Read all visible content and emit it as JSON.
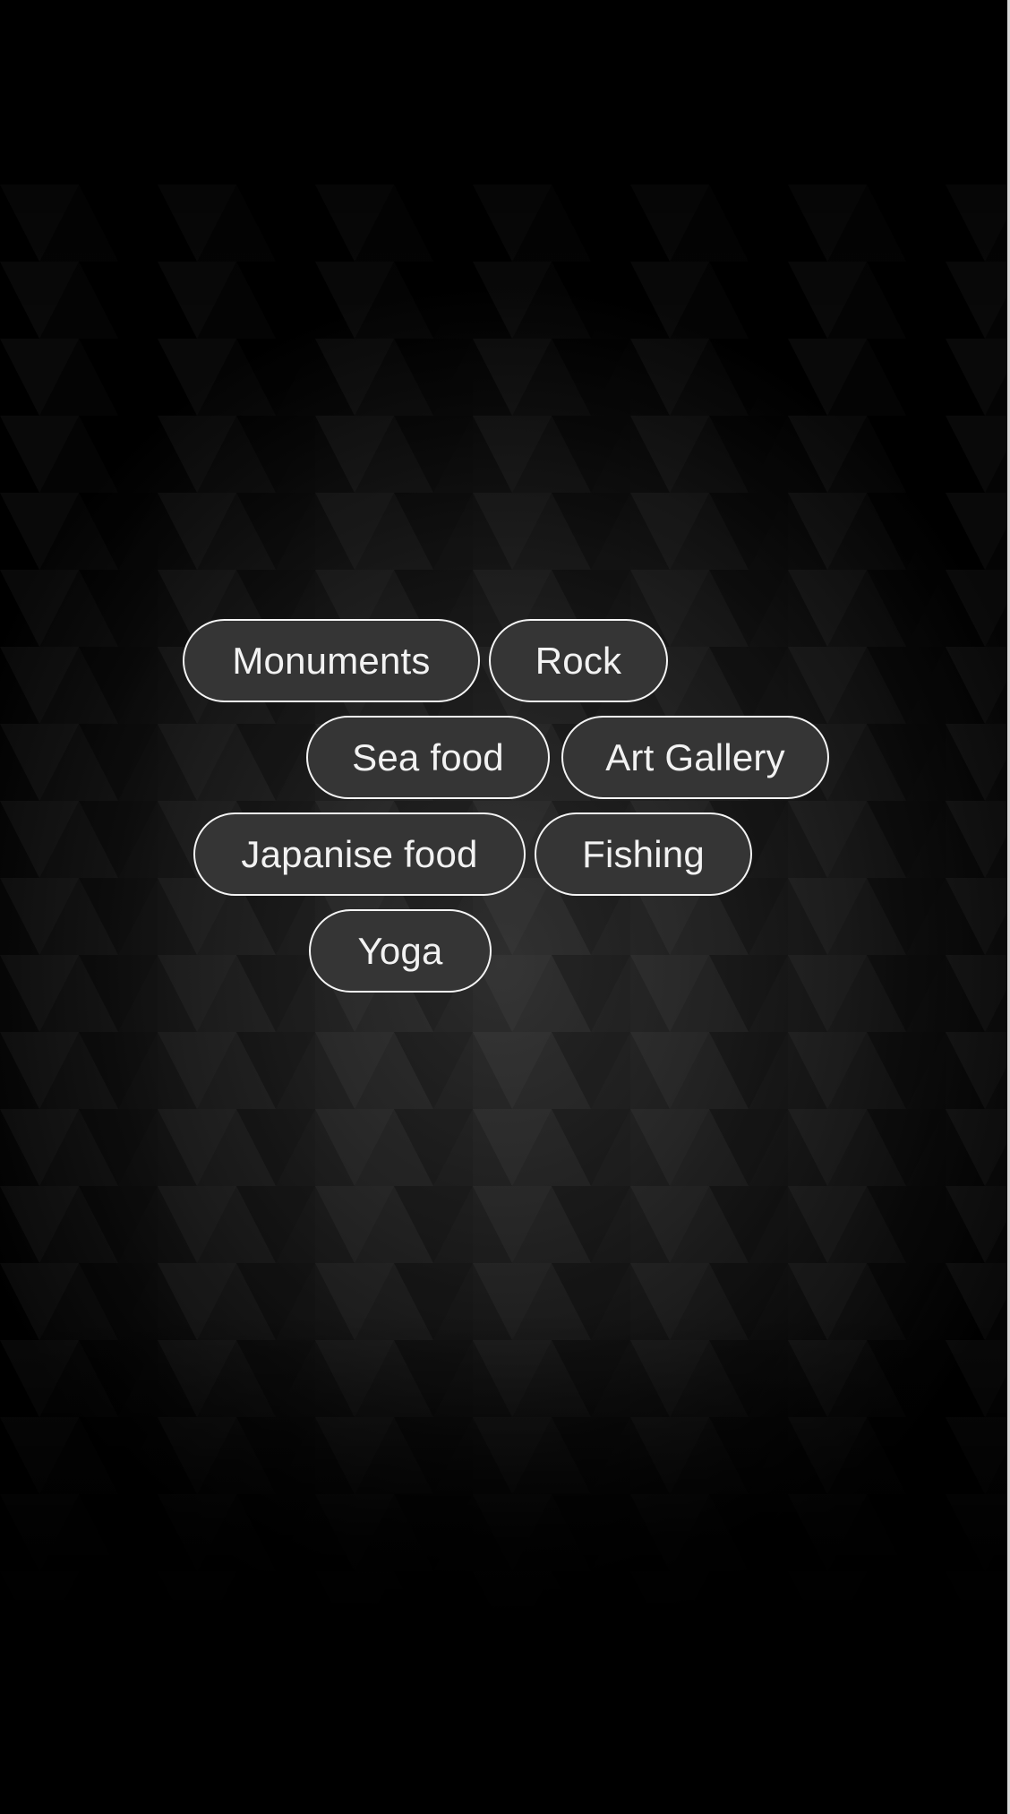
{
  "tags": [
    {
      "label": "Monuments"
    },
    {
      "label": "Rock"
    },
    {
      "label": "Sea food"
    },
    {
      "label": "Art Gallery"
    },
    {
      "label": "Japanise food"
    },
    {
      "label": "Fishing"
    },
    {
      "label": "Yoga"
    }
  ],
  "colors": {
    "background": "#000000",
    "chip_fill": "#353535",
    "chip_border": "#f4f4f4",
    "chip_text": "#f2f2f2"
  }
}
